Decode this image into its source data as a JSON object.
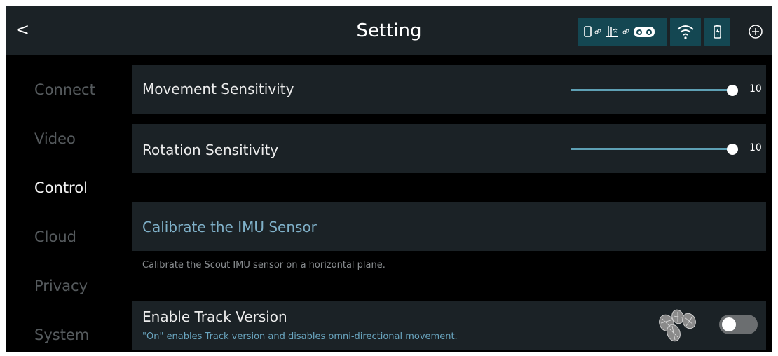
{
  "header": {
    "back_label": "<",
    "title": "Setting",
    "icons": [
      "phone-icon",
      "link-icon",
      "router-icon",
      "link-icon",
      "vr-headset-icon",
      "wifi-icon",
      "battery-charging-icon",
      "add-circle-icon"
    ]
  },
  "sidebar": {
    "items": [
      {
        "label": "Connect",
        "active": false
      },
      {
        "label": "Video",
        "active": false
      },
      {
        "label": "Control",
        "active": true
      },
      {
        "label": "Cloud",
        "active": false
      },
      {
        "label": "Privacy",
        "active": false
      },
      {
        "label": "System",
        "active": false
      }
    ]
  },
  "settings": {
    "movement": {
      "label": "Movement Sensitivity",
      "value": "10",
      "fraction": 1.0
    },
    "rotation": {
      "label": "Rotation Sensitivity",
      "value": "10",
      "fraction": 1.0
    },
    "calibrate": {
      "label": "Calibrate the IMU Sensor",
      "description": "Calibrate the Scout IMU sensor on a horizontal plane."
    },
    "track": {
      "label": "Enable Track Version",
      "description": "\"On\" enables Track version and disables omni-directional movement.",
      "enabled": false
    }
  },
  "colors": {
    "accent": "#5ea0b4",
    "panel": "#1b2226",
    "status_box": "#144752"
  }
}
